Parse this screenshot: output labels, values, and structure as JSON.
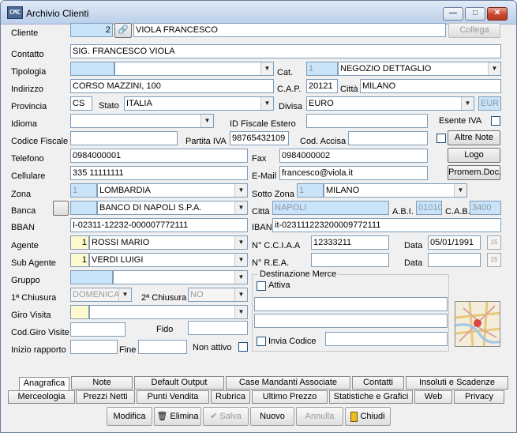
{
  "window": {
    "title": "Archivio Clienti",
    "app_icon": "app-icon",
    "min_label": "—",
    "max_label": "□",
    "close_label": "✕"
  },
  "cliente": {
    "label": "Cliente",
    "code": "2",
    "name": "VIOLA FRANCESCO",
    "collega": "Collega"
  },
  "contatto": {
    "label": "Contatto",
    "value": "SIG. FRANCESCO VIOLA"
  },
  "tipologia": {
    "label": "Tipologia",
    "value": ""
  },
  "cat": {
    "label": "Cat.",
    "code": "1",
    "value": "NEGOZIO DETTAGLIO"
  },
  "indirizzo": {
    "label": "Indirizzo",
    "value": "CORSO MAZZINI, 100"
  },
  "cap": {
    "label": "C.A.P.",
    "value": "20121"
  },
  "citta": {
    "label": "Città",
    "value": "MILANO"
  },
  "provincia": {
    "label": "Provincia",
    "value": "CS"
  },
  "stato": {
    "label": "Stato",
    "value": "ITALIA"
  },
  "divisa": {
    "label": "Divisa",
    "value": "EURO",
    "code": "EUR"
  },
  "idioma": {
    "label": "Idioma",
    "value": ""
  },
  "id_fiscale": {
    "label": "ID Fiscale Estero",
    "value": ""
  },
  "esente_iva": {
    "label": "Esente IVA"
  },
  "codice_fiscale": {
    "label": "Codice Fiscale",
    "value": ""
  },
  "partita_iva": {
    "label": "Partita IVA",
    "value": "98765432109"
  },
  "cod_accisa": {
    "label": "Cod. Accisa",
    "value": ""
  },
  "altre_note": "Altre Note",
  "telefono": {
    "label": "Telefono",
    "value": "0984000001"
  },
  "fax": {
    "label": "Fax",
    "value": "0984000002"
  },
  "logo": "Logo",
  "cellulare": {
    "label": "Cellulare",
    "value": "335 11111111"
  },
  "email": {
    "label": "E-Mail",
    "value": "francesco@viola.it"
  },
  "promem": "Promem.Doc.",
  "zona": {
    "label": "Zona",
    "code": "1",
    "value": "LOMBARDIA"
  },
  "sottozona": {
    "label": "Sotto Zona",
    "code": "1",
    "value": "MILANO"
  },
  "banca": {
    "label": "Banca",
    "value": "BANCO DI NAPOLI S.P.A."
  },
  "banca_citta": {
    "label": "Città",
    "value": "NAPOLI"
  },
  "abi": {
    "label": "A.B.I.",
    "value": "01010"
  },
  "cab": {
    "label": "C.A.B.",
    "value": "3400"
  },
  "bban": {
    "label": "BBAN",
    "value": "I-02311-12232-000007772111"
  },
  "iban": {
    "label": "IBAN",
    "value": "it-023111223200009772111"
  },
  "agente": {
    "label": "Agente",
    "code": "1",
    "value": "ROSSI MARIO"
  },
  "cciaa": {
    "label": "N° C.C.I.A.A",
    "value": "12333211"
  },
  "data1": {
    "label": "Data",
    "value": "05/01/1991"
  },
  "subagente": {
    "label": "Sub Agente",
    "code": "1",
    "value": "VERDI LUIGI"
  },
  "rea": {
    "label": "N° R.E.A.",
    "value": ""
  },
  "data2": {
    "label": "Data",
    "value": ""
  },
  "gruppo": {
    "label": "Gruppo",
    "value": ""
  },
  "chiusura1": {
    "label": "1ª Chiusura",
    "value": "DOMENICA"
  },
  "chiusura2": {
    "label": "2ª Chiusura",
    "value": "NO"
  },
  "giro": {
    "label": "Giro Visita",
    "value": ""
  },
  "codgiro": {
    "label": "Cod.Giro Visite",
    "value": ""
  },
  "fido": {
    "label": "Fido",
    "value": ""
  },
  "inizio": {
    "label": "Inizio rapporto",
    "value": ""
  },
  "fine": {
    "label": "Fine",
    "value": ""
  },
  "non_attivo": {
    "label": "Non attivo"
  },
  "dest": {
    "title": "Destinazione Merce",
    "attiva": "Attiva",
    "line1": "",
    "line2": "",
    "invia": "Invia Codice",
    "invia_val": ""
  },
  "tabs_row1": [
    "Anagrafica",
    "Note",
    "Default Output",
    "Case Mandanti Associate",
    "Contatti",
    "Insoluti e Scadenze"
  ],
  "tabs_row2": [
    "Merceologia",
    "Prezzi Netti",
    "Punti Vendita",
    "Rubrica",
    "Ultimo Prezzo",
    "Statistiche e Grafici",
    "Web",
    "Privacy"
  ],
  "actions": {
    "modifica": "Modifica",
    "elimina": "Elimina",
    "salva": "Salva",
    "nuovo": "Nuovo",
    "annulla": "Annulla",
    "chiudi": "Chiudi"
  }
}
